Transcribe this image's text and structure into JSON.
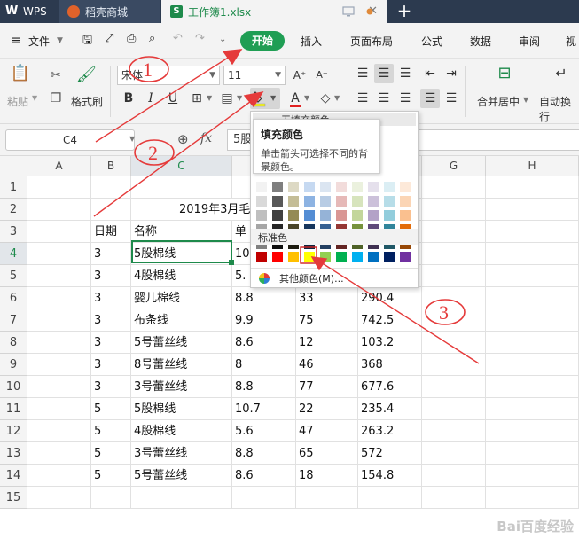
{
  "tabs": {
    "wps": "WPS",
    "shop": "稻壳商城",
    "file": "工作簿1.xlsx"
  },
  "menu": {
    "file": "文件",
    "start": "开始",
    "insert": "插入",
    "page_layout": "页面布局",
    "formula": "公式",
    "data": "数据",
    "review": "审阅",
    "view": "视"
  },
  "ribbon": {
    "paste": "粘贴",
    "format_painter": "格式刷",
    "font_name": "宋体",
    "font_size": "11",
    "merge_center": "合并居中",
    "wrap_text": "自动换行"
  },
  "formula_bar": {
    "name_box": "C4",
    "fx": "fx",
    "formula_text": "5股"
  },
  "columns": [
    "A",
    "B",
    "C",
    "D",
    "E",
    "F",
    "G",
    "H"
  ],
  "rows": [
    "1",
    "2",
    "3",
    "4",
    "5",
    "6",
    "7",
    "8",
    "9",
    "10",
    "11",
    "12",
    "13",
    "14",
    "15"
  ],
  "sheet": {
    "title": "2019年3月毛",
    "headers": [
      "日期",
      "名称",
      "单"
    ],
    "data": [
      [
        "3",
        "5股棉线",
        "10",
        "",
        ""
      ],
      [
        "3",
        "4股棉线",
        "5.",
        "",
        ""
      ],
      [
        "3",
        "婴儿棉线",
        "8.8",
        "33",
        "290.4"
      ],
      [
        "3",
        "布条线",
        "9.9",
        "75",
        "742.5"
      ],
      [
        "3",
        "5号蕾丝线",
        "8.6",
        "12",
        "103.2"
      ],
      [
        "3",
        "8号蕾丝线",
        "8",
        "46",
        "368"
      ],
      [
        "3",
        "3号蕾丝线",
        "8.8",
        "77",
        "677.6"
      ],
      [
        "5",
        "5股棉线",
        "10.7",
        "22",
        "235.4"
      ],
      [
        "5",
        "4股棉线",
        "5.6",
        "47",
        "263.2"
      ],
      [
        "5",
        "3号蕾丝线",
        "8.8",
        "65",
        "572"
      ],
      [
        "5",
        "5号蕾丝线",
        "8.6",
        "18",
        "154.8"
      ]
    ]
  },
  "fill_panel": {
    "top_item": "无填充颜色",
    "standard_label": "标准色",
    "more_colors": "其他颜色(M)...",
    "standard_colors": [
      "#c00000",
      "#ff0000",
      "#ffc000",
      "#ffff00",
      "#92d050",
      "#00b050",
      "#00b0f0",
      "#0070c0",
      "#002060",
      "#7030a0"
    ],
    "theme_rows": [
      [
        "#f2f2f2",
        "#7f7f7f",
        "#ddd9c4",
        "#c6d9f1",
        "#dbe5f1",
        "#f2dcdb",
        "#ebf1de",
        "#e5e0ec",
        "#dbeef4",
        "#fde9d9"
      ],
      [
        "#d9d9d9",
        "#595959",
        "#c4bd97",
        "#8db3e2",
        "#b8cce4",
        "#e6b9b8",
        "#d7e4bd",
        "#ccc1da",
        "#b7dde8",
        "#fbd5b5"
      ],
      [
        "#bfbfbf",
        "#404040",
        "#948a54",
        "#548dd4",
        "#95b3d7",
        "#d99694",
        "#c3d69b",
        "#b3a2c7",
        "#92cddc",
        "#fac08f"
      ],
      [
        "#a6a6a6",
        "#262626",
        "#4a452a",
        "#17365d",
        "#366092",
        "#953734",
        "#76923c",
        "#5f497a",
        "#31859b",
        "#e36c09"
      ],
      [
        "#808080",
        "#0d0d0d",
        "#1d1b10",
        "#0f243e",
        "#244061",
        "#632523",
        "#4f6228",
        "#3f3151",
        "#205867",
        "#974806"
      ]
    ]
  },
  "tooltip": {
    "title": "填充颜色",
    "desc": "单击箭头可选择不同的背景颜色。"
  },
  "annotations": [
    "1",
    "2",
    "3"
  ],
  "watermark": "Bai百度经验"
}
